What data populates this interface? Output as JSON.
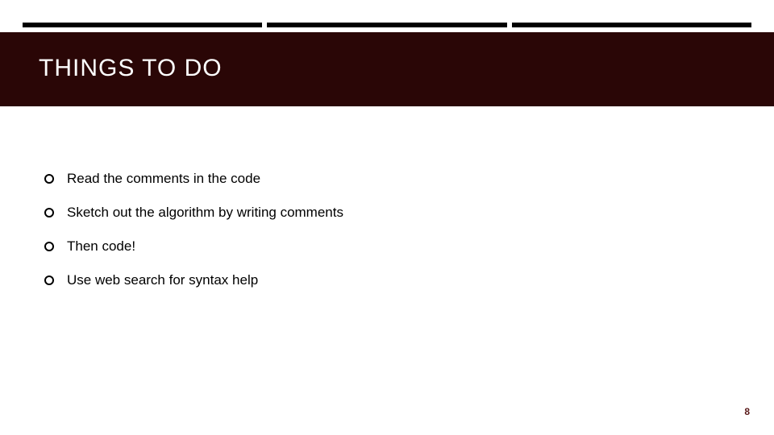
{
  "header": {
    "title": "THINGS TO DO"
  },
  "bullets": {
    "items": [
      {
        "text": "Read the comments in the code"
      },
      {
        "text": "Sketch out the algorithm by writing comments"
      },
      {
        "text": "Then code!"
      },
      {
        "text": "Use web search for syntax help"
      }
    ]
  },
  "footer": {
    "page_number": "8"
  }
}
